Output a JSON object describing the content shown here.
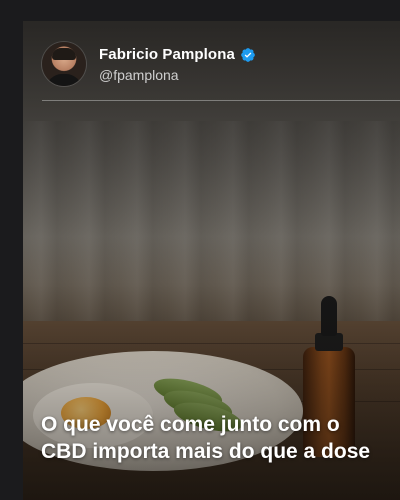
{
  "post": {
    "author": {
      "name": "Fabricio Pamplona",
      "handle": "@fpamplona",
      "verified": true
    },
    "headline": "O que você come junto com o CBD importa mais do que a dose",
    "image_description_icons": {
      "verified_icon": "verified-badge-icon"
    }
  },
  "colors": {
    "verified": "#1d9bf0",
    "headline_text": "#ffffff",
    "handle_text": "#cfcfcf"
  }
}
